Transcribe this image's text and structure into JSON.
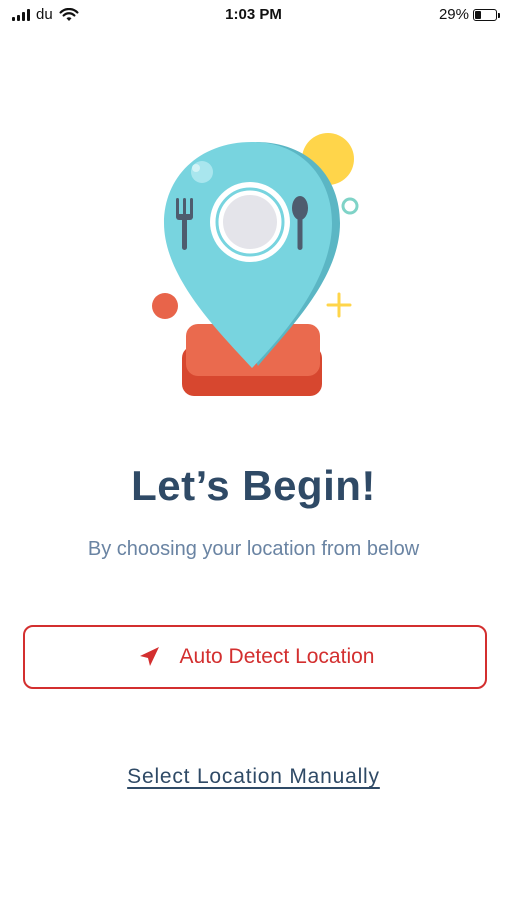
{
  "status_bar": {
    "carrier": "du",
    "time": "1:03 PM",
    "battery_percent": "29%",
    "battery_level": 0.29,
    "icons": [
      "signal-icon",
      "wifi-icon",
      "battery-icon"
    ]
  },
  "illustration": {
    "icon": "location-pin-plate-fork-spoon-icon"
  },
  "main": {
    "title": "Let’s Begin!",
    "subtitle": "By choosing your location from below"
  },
  "actions": {
    "auto_detect_label": "Auto Detect Location",
    "auto_detect_icon": "navigation-arrow-icon",
    "manual_label": "Select Location Manually"
  },
  "colors": {
    "accent_red": "#d32f2f",
    "title_navy": "#2f4a66",
    "subtitle_gray_blue": "#6a84a3",
    "pin_teal": "#78d4df",
    "sun_yellow": "#ffd54a",
    "base_orange": "#e8644a"
  }
}
